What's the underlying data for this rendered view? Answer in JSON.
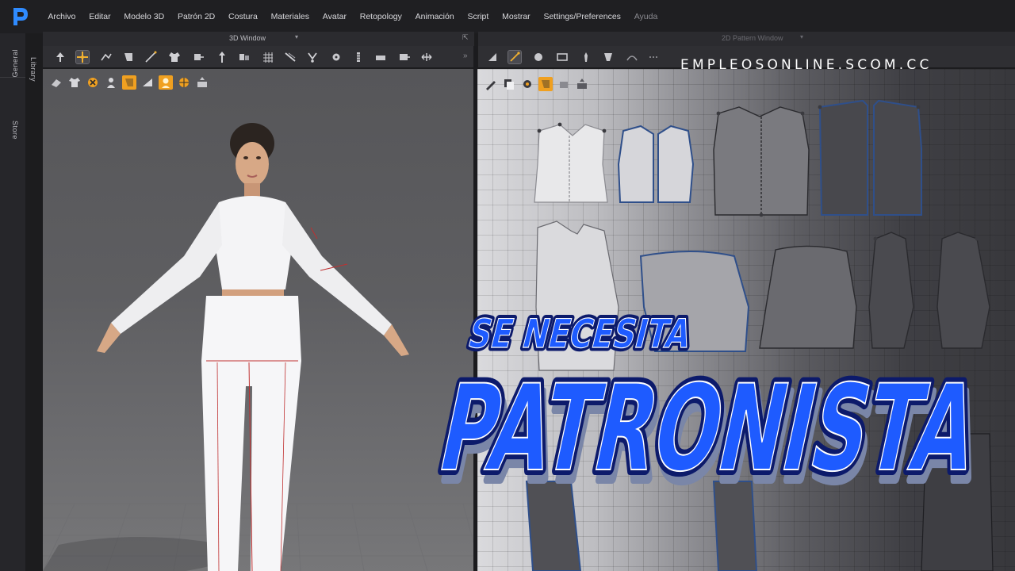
{
  "app": {
    "menu": [
      "Archivo",
      "Editar",
      "Modelo 3D",
      "Patrón 2D",
      "Costura",
      "Materiales",
      "Avatar",
      "Retopology",
      "Animación",
      "Script",
      "Mostrar",
      "Settings/Preferences",
      "Ayuda"
    ],
    "side_tabs": [
      "Library",
      "General",
      "Store"
    ]
  },
  "window_3d": {
    "title": "3D Window"
  },
  "window_2d": {
    "title": "2D Pattern Window"
  },
  "overlay": {
    "watermark": "EMPLEOSONLINE.SCOM.CC",
    "tagline": "SE NECESITA",
    "headline": "PATRONISTA"
  },
  "colors": {
    "accent_blue": "#1e5bff",
    "accent_outline": "#0c1a6b",
    "panel": "#2f2f33",
    "menubar": "#1f1f22",
    "orange_tool": "#f0a020"
  },
  "icons": {
    "app_logo": "clo-logo-icon",
    "toolbar_3d": [
      "move-icon",
      "select-transform-icon",
      "edit-pattern-icon",
      "fold-icon",
      "draw-line-icon",
      "garment-icon",
      "sewing-icon",
      "pin-icon",
      "arrange-icon",
      "grid-icon",
      "style-line-icon",
      "tack-icon",
      "button-icon",
      "zipper-icon",
      "measure-icon",
      "topstitch-icon",
      "flip-icon"
    ],
    "viewport_3d": [
      "shaded-texture-icon",
      "avatar-shirt-icon",
      "simulation-icon",
      "avatar-icon",
      "fold-orange-icon",
      "ruler-icon",
      "avatar-face-icon",
      "globe-icon",
      "snapshot-icon"
    ],
    "toolbar_2d": [
      "transform-pattern-icon",
      "edit-point-icon",
      "circle-icon",
      "rectangle-icon",
      "polygon-icon",
      "internal-shape-icon",
      "curve-icon",
      "seam-icon"
    ],
    "viewport_2d": [
      "pencil-icon",
      "copy-icon",
      "texture-icon",
      "fold-orange-icon",
      "rect-icon",
      "snapshot-icon"
    ]
  }
}
